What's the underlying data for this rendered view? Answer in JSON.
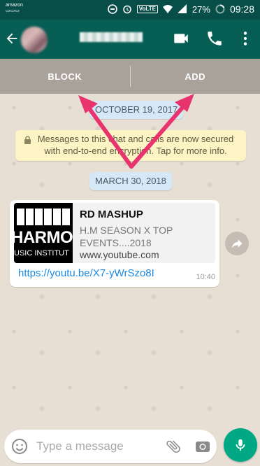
{
  "status_bar": {
    "battery_percent": "27%",
    "time": "09:28",
    "network_badge": "VoLTE",
    "notification_icons": [
      "amazon-icon",
      "circle-notification-icon",
      "alarm-icon"
    ]
  },
  "app_bar": {
    "contact_name": "",
    "icons": [
      "back-arrow-icon",
      "video-call-icon",
      "phone-icon",
      "more-vert-icon"
    ]
  },
  "action_strip": {
    "block_label": "BLOCK",
    "add_label": "ADD"
  },
  "chat": {
    "date_1": "OCTOBER 19, 2017",
    "encryption_notice": "Messages to this chat and calls are now secured with end-to-end encryption. Tap for more info.",
    "date_2": "MARCH 30, 2018",
    "message": {
      "preview_title": "RD MASHUP",
      "preview_description": "H.M SEASON X TOP EVENTS....2018",
      "preview_site": "www.youtube.com",
      "thumbnail_text": "HARMON",
      "thumbnail_subtext": "USIC INSTITUT",
      "link": "https://youtu.be/X7-yWrSzo8I",
      "time": "10:40"
    }
  },
  "composer": {
    "placeholder": "Type a message"
  },
  "colors": {
    "header": "#075e54",
    "status_bar": "#064e47",
    "accent": "#00a884",
    "annotation_arrow": "#e8336f",
    "link": "#1a8ae5"
  }
}
